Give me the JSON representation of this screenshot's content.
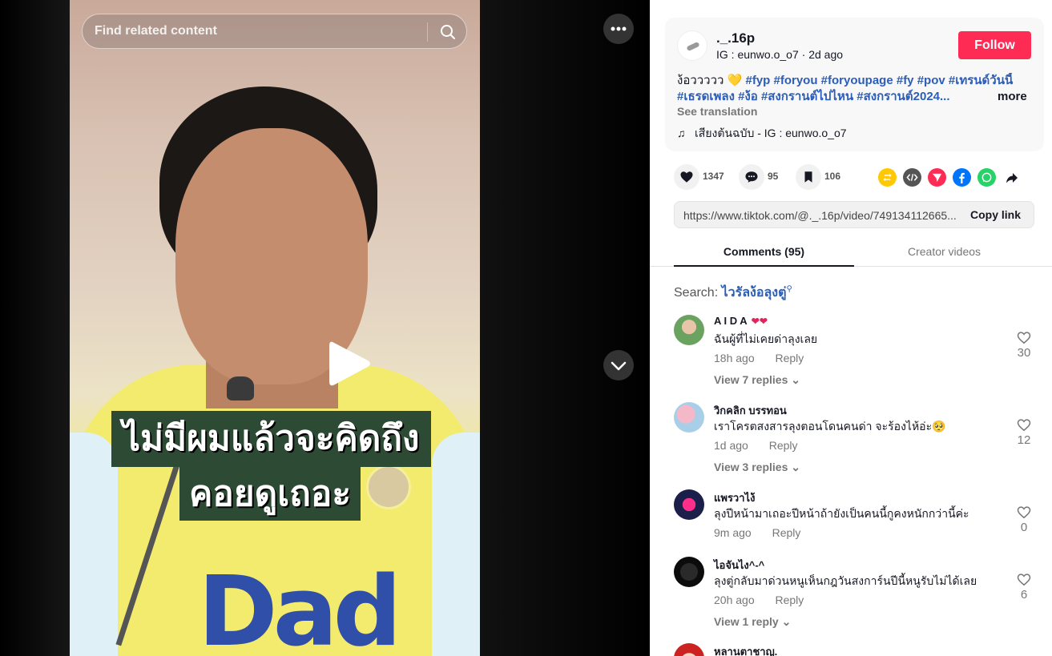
{
  "search": {
    "placeholder": "Find related content"
  },
  "video": {
    "caption_line1": "ไม่มีผมแล้วจะคิดถึง",
    "caption_line2": "คอยดูเถอะ",
    "shirt_logo_text": "Dad"
  },
  "post": {
    "username": "._.16p",
    "sub_author": "IG : eunwo.o_o7",
    "sub_time": "2d ago",
    "sub_separator": " · ",
    "follow_label": "Follow",
    "desc_prefix": "ง้อววววว",
    "desc_emoji": "💛",
    "desc_tags_line1": "#fyp #foryou #foryoupage #fy #pov #เทรนด์วันนี้",
    "desc_tags_line2": "#เธรดเพลง #ง้อ #สงกรานต์ไปไหน #สงกรานต์2024...",
    "more_label": "more",
    "translate_label": "See translation",
    "music_icon": "♫",
    "music_label": "เสียงต้นฉบับ - IG : eunwo.o_o7"
  },
  "actions": {
    "likes": "1347",
    "comments": "95",
    "saves": "106"
  },
  "share_icons": [
    "repost-icon",
    "embed-icon",
    "send-icon",
    "facebook-icon",
    "whatsapp-icon",
    "share-arrow-icon"
  ],
  "colors": {
    "follow": "#fe2c55",
    "repost": "#fec900",
    "embed": "#555555",
    "send": "#fe2c55",
    "facebook": "#0075fa",
    "whatsapp": "#25d366",
    "tag": "#2b5db9"
  },
  "link": {
    "url": "https://www.tiktok.com/@._.16p/video/749134112665...",
    "copy_label": "Copy link"
  },
  "tabs": {
    "comments": "Comments (95)",
    "creator": "Creator videos"
  },
  "search_suggestion": {
    "label": "Search: ",
    "query": "ไวรัลง้อลุงตู่"
  },
  "comments": [
    {
      "name": "A I D A",
      "text": "ฉันผู้ที่ไม่เคยด่าลุงเลย",
      "time": "18h ago",
      "reply": "Reply",
      "replies": "View 7 replies",
      "likes": "30"
    },
    {
      "name": "วิกคลิก บรรทอน",
      "text": "เราโครตสงสารลุงตอนโดนคนด่า จะร้องไห้อ่ะ🥺",
      "time": "1d ago",
      "reply": "Reply",
      "replies": "View 3 replies",
      "likes": "12"
    },
    {
      "name": "แพรวาไง้",
      "text": "ลุงปีหน้ามาเถอะปีหน้าถ้ายังเป็นคนนี้กูคงหนักกว่านี้ค่ะ",
      "time": "9m ago",
      "reply": "Reply",
      "replies": "",
      "likes": "0"
    },
    {
      "name": "ไอจันไง^-^",
      "text": "ลุงตู่กลับมาด่วนหนูเห็นกฎวันสงการ์นปีนี้หนูรับไม่ได้เลย",
      "time": "20h ago",
      "reply": "Reply",
      "replies": "View 1 reply",
      "likes": "6"
    },
    {
      "name": "หลานตาชาญ.",
      "text": "",
      "time": "",
      "reply": "",
      "replies": "",
      "likes": ""
    }
  ]
}
